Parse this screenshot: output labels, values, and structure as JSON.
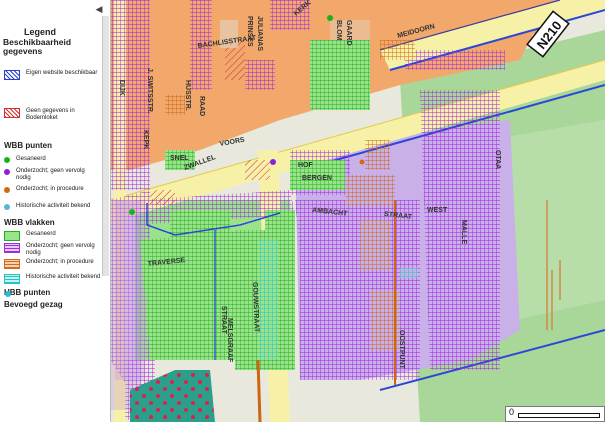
{
  "legend": {
    "title": "Legend",
    "subtitle": "Beschikbaarheid gegevens",
    "items_availability": [
      {
        "label": "Eigen website beschikbaar",
        "color": "#2b3fcf",
        "icon": "blue-hatch-box"
      },
      {
        "label": "Geen gegevens in Bodemloket",
        "color": "#d03030",
        "icon": "red-hatch-box"
      }
    ],
    "wbb_punten_title": "WBB punten",
    "wbb_punten": [
      {
        "label": "Gesaneerd",
        "color": "#17b31d",
        "icon": "green-dot"
      },
      {
        "label": "Onderzocht; geen vervolg nodig",
        "color": "#8d1fd6",
        "icon": "purple-dot"
      },
      {
        "label": "Onderzocht; in procedure",
        "color": "#d26a12",
        "icon": "orange-dot"
      },
      {
        "label": "Historische activiteit bekend",
        "color": "#58b4d8",
        "icon": "lightblue-dot"
      }
    ],
    "wbb_vlakken_title": "WBB vlakken",
    "wbb_vlakken": [
      {
        "label": "Gesaneerd",
        "color": "#22b022",
        "icon": "green-grid-box"
      },
      {
        "label": "Onderzocht; geen vervolg nodig",
        "color": "#a02ce0",
        "icon": "purple-grid-box"
      },
      {
        "label": "Onderzocht; in procedure",
        "color": "#d36a1a",
        "icon": "orange-grid-box"
      },
      {
        "label": "Historische activiteit bekend",
        "color": "#20c4c4",
        "icon": "cyan-grid-box"
      }
    ],
    "hbb_title": "HBB punten",
    "hbb_dot_color": "#22c0d8",
    "bevoegd_title": "Bevoegd gezag"
  },
  "map": {
    "road_label": "N210",
    "street_labels": [
      "PRINSES",
      "JULIANAS",
      "BLOM",
      "GAARD",
      "MEIDOORN",
      "KERK",
      "BACHLISSTRAAT",
      "J. SWITSSTR.",
      "HUSSTR.",
      "RAAD",
      "KEPK",
      "VOORS",
      "ZWALLEL",
      "SNEL",
      "HOF",
      "BERGEN",
      "AMBACHT",
      "STRAAT",
      "TRAVERSE",
      "GOUWSTRAAT",
      "MELSGRAAF",
      "STRAAT",
      "OOSTPUNT",
      "MALLE",
      "WEST",
      "OTAA",
      "DIJK"
    ],
    "colors": {
      "built_area": "#f2a86b",
      "road": "#f7f1a8",
      "water": "#7aa8e0",
      "grass": "#a9d79a",
      "lavender": "#c9b0e8"
    }
  },
  "scale": {
    "zero_label": "0"
  }
}
